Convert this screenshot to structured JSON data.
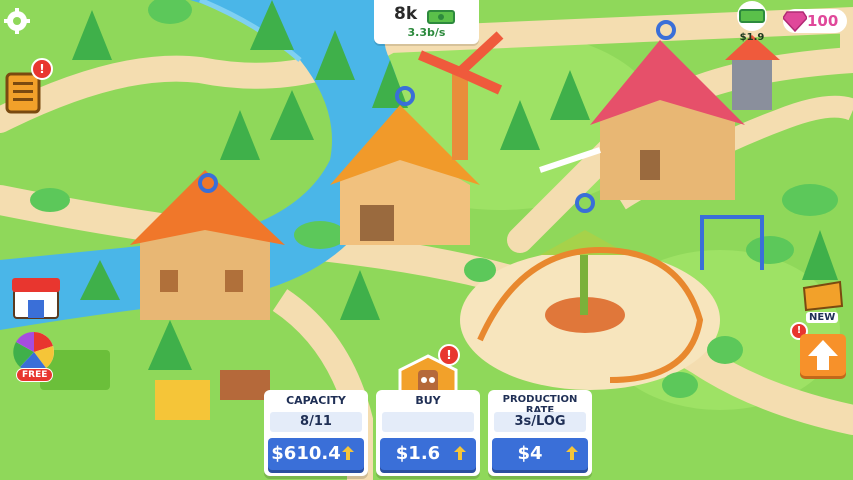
{
  "hud": {
    "money": "8k",
    "money_rate": "3.3b/s",
    "gems": "100",
    "nearby_cash": "$1.9",
    "alert_mark": "!",
    "free_label": "FREE",
    "new_label": "NEW"
  },
  "panels": [
    {
      "title": "CAPACITY",
      "value": "8/11",
      "price": "$610.4"
    },
    {
      "title": "BUY",
      "value": "",
      "price": "$1.6"
    },
    {
      "title": "PRODUCTION RATE",
      "value": "3s/LOG",
      "price": "$4"
    }
  ],
  "colors": {
    "grass": "#8fd85a",
    "path": "#f4ddb0",
    "water": "#4ab6e8",
    "button_blue": "#3a6fd8",
    "upgrade_orange": "#f7912a",
    "gem_pink": "#e0489a",
    "alert_red": "#e8362f"
  },
  "icons": [
    "gear-icon",
    "task-list-icon",
    "shop-icon",
    "prize-wheel-icon",
    "cash-stack-icon",
    "gem-icon",
    "new-building-icon",
    "up-arrow-icon",
    "log-worker-icon"
  ]
}
